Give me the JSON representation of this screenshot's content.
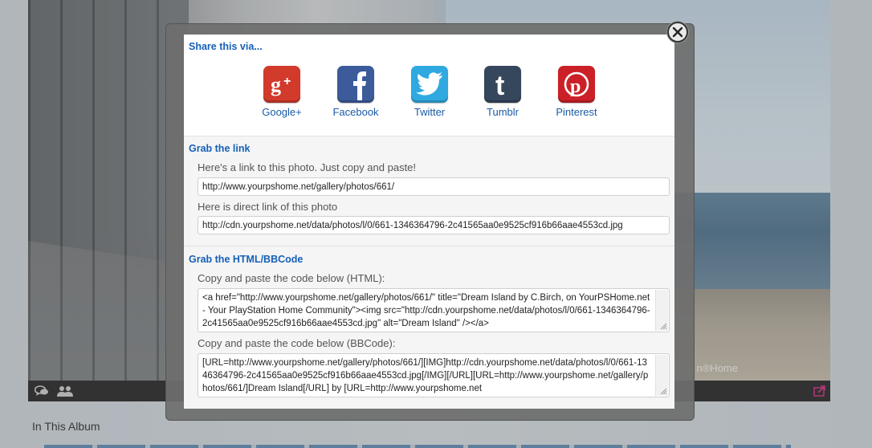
{
  "background": {
    "watermark": "n®Home",
    "album_heading": "In This Album",
    "toolbar": {
      "comments_icon": "comments-icon",
      "people_icon": "people-icon",
      "share_icon": "share-icon"
    }
  },
  "modal": {
    "close_icon": "close-icon",
    "share": {
      "title": "Share this via...",
      "services": [
        {
          "label": "Google+",
          "icon": "google-plus-icon",
          "color": "#d23a2b"
        },
        {
          "label": "Facebook",
          "icon": "facebook-icon",
          "color": "#3b5b9a"
        },
        {
          "label": "Twitter",
          "icon": "twitter-icon",
          "color": "#2fa9e0"
        },
        {
          "label": "Tumblr",
          "icon": "tumblr-icon",
          "color": "#36465d"
        },
        {
          "label": "Pinterest",
          "icon": "pinterest-icon",
          "color": "#cb2027"
        }
      ]
    },
    "link": {
      "title": "Grab the link",
      "photo_link_label": "Here's a link to this photo. Just copy and paste!",
      "photo_link_value": "http://www.yourpshome.net/gallery/photos/661/",
      "direct_link_label": "Here is direct link of this photo",
      "direct_link_value": "http://cdn.yourpshome.net/data/photos/l/0/661-1346364796-2c41565aa0e9525cf916b66aae4553cd.jpg"
    },
    "code": {
      "title": "Grab the HTML/BBCode",
      "html_label": "Copy and paste the code below (HTML):",
      "html_value": "<a href=\"http://www.yourpshome.net/gallery/photos/661/\" title=\"Dream Island by C.Birch, on YourPSHome.net - Your PlayStation Home Community\"><img src=\"http://cdn.yourpshome.net/data/photos/l/0/661-1346364796-2c41565aa0e9525cf916b66aae4553cd.jpg\" alt=\"Dream Island\" /></a>",
      "bbcode_label": "Copy and paste the code below (BBCode):",
      "bbcode_value": "[URL=http://www.yourpshome.net/gallery/photos/661/][IMG]http://cdn.yourpshome.net/data/photos/l/0/661-1346364796-2c41565aa0e9525cf916b66aae4553cd.jpg[/IMG][/URL][URL=http://www.yourpshome.net/gallery/photos/661/]Dream Island[/URL] by [URL=http://www.yourpshome.net"
    }
  }
}
